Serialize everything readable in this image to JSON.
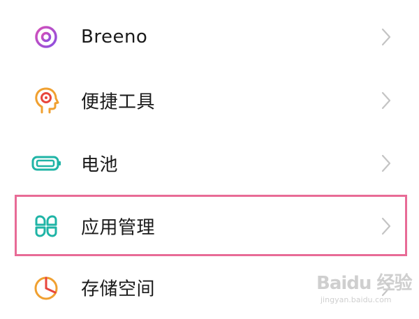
{
  "settings": {
    "items": [
      {
        "label": "Breeno",
        "icon": "breeno-icon"
      },
      {
        "label": "便捷工具",
        "icon": "convenience-tools-icon"
      },
      {
        "label": "电池",
        "icon": "battery-icon"
      },
      {
        "label": "应用管理",
        "icon": "app-management-icon"
      },
      {
        "label": "存储空间",
        "icon": "storage-icon"
      }
    ]
  },
  "highlight": {
    "target": "应用管理",
    "color": "#e86b96"
  },
  "watermark": {
    "main": "Baidu 经验",
    "sub": "jingyan.baidu.com"
  },
  "colors": {
    "breeno": "#b34fd6",
    "tools": "#f0a030",
    "tools_dot": "#e8453c",
    "battery": "#1fb4a6",
    "apps": "#1fb4a6",
    "storage_arc": "#f0a030",
    "storage_slice": "#e8453c",
    "chevron": "#c4c4c4"
  }
}
